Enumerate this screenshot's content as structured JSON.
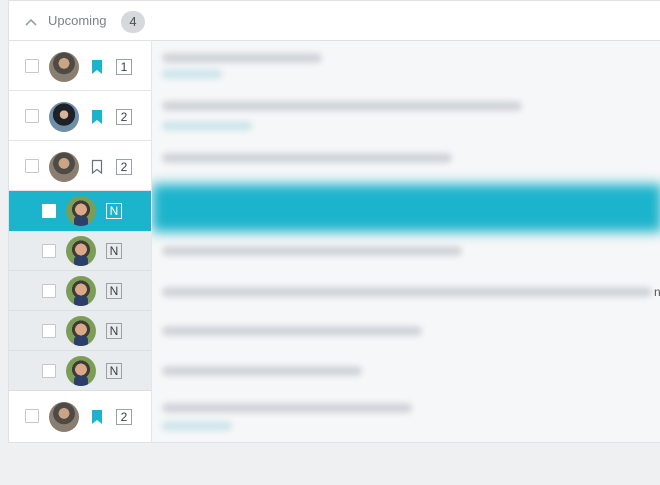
{
  "section": {
    "label": "Upcoming",
    "count": "4"
  },
  "colors": {
    "accent": "#1cb3cc",
    "subtask_bg": "#e9ecef"
  },
  "rows": [
    {
      "kind": "task",
      "avatar": "man-cap",
      "bookmark": "filled",
      "number": "1"
    },
    {
      "kind": "task",
      "avatar": "man-dark",
      "bookmark": "filled",
      "number": "2"
    },
    {
      "kind": "task",
      "avatar": "man-cap",
      "bookmark": "outline",
      "number": "2"
    },
    {
      "kind": "subtask",
      "avatar": "man-smile",
      "tag": "N",
      "selected": true
    },
    {
      "kind": "subtask",
      "avatar": "man-smile",
      "tag": "N"
    },
    {
      "kind": "subtask",
      "avatar": "man-smile",
      "tag": "N"
    },
    {
      "kind": "subtask",
      "avatar": "man-smile",
      "tag": "N"
    },
    {
      "kind": "subtask",
      "avatar": "man-smile",
      "tag": "N"
    },
    {
      "kind": "task",
      "avatar": "man-cap",
      "bookmark": "filled",
      "number": "2"
    }
  ],
  "content": {
    "edge_text": "nd"
  }
}
